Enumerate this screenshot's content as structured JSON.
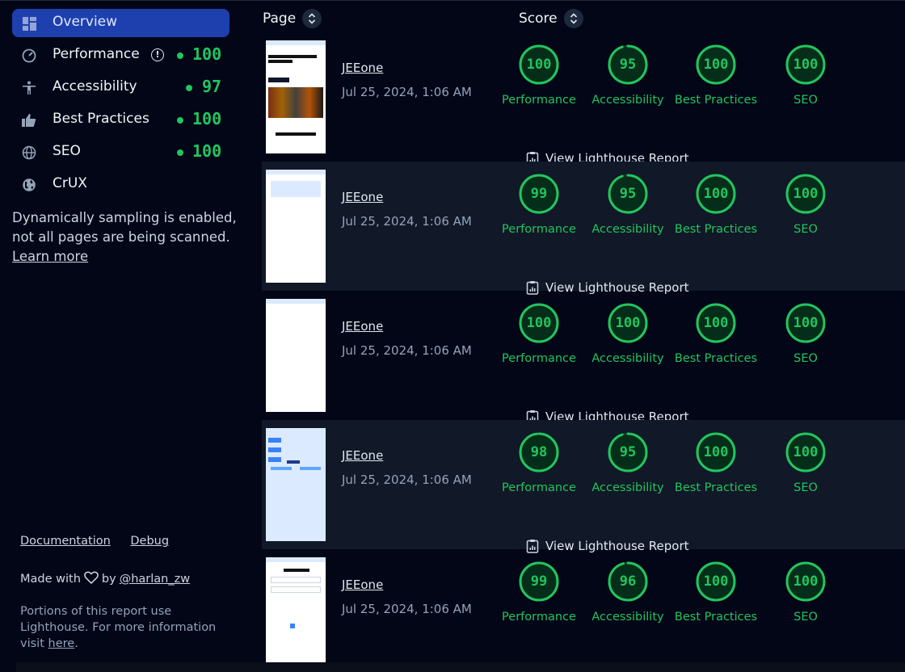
{
  "sidebar": {
    "nav": [
      {
        "label": "Overview",
        "icon": "dashboard-icon",
        "score": ""
      },
      {
        "label": "Performance",
        "icon": "speedometer-icon",
        "score": "100"
      },
      {
        "label": "Accessibility",
        "icon": "person-icon",
        "score": "97"
      },
      {
        "label": "Best Practices",
        "icon": "thumbs-up-icon",
        "score": "100"
      },
      {
        "label": "SEO",
        "icon": "globe-icon",
        "score": "100"
      },
      {
        "label": "CrUX",
        "icon": "earth-icon",
        "score": ""
      }
    ],
    "sampling_note": "Dynamically sampling is enabled, not all pages are being scanned.",
    "learn_more": "Learn more",
    "links": {
      "documentation": "Documentation",
      "debug": "Debug"
    },
    "made_with": {
      "prefix": "Made with",
      "by": "by",
      "handle": "@harlan_zw"
    },
    "portions": {
      "text": "Portions of this report use Lighthouse. For more information visit",
      "link": "here",
      "suffix": "."
    }
  },
  "table": {
    "page_header": "Page",
    "score_header": "Score",
    "report_label": "View Lighthouse Report",
    "category_labels": [
      "Performance",
      "Accessibility",
      "Best Practices",
      "SEO"
    ],
    "rows": [
      {
        "site": "JEEone",
        "date": "Jul 25, 2024, 1:06 AM",
        "scores": [
          "100",
          "95",
          "100",
          "100"
        ],
        "thumb": "home"
      },
      {
        "site": "JEEone",
        "date": "Jul 25, 2024, 1:06 AM",
        "scores": [
          "99",
          "95",
          "100",
          "100"
        ],
        "thumb": "test"
      },
      {
        "site": "JEEone",
        "date": "Jul 25, 2024, 1:06 AM",
        "scores": [
          "100",
          "100",
          "100",
          "100"
        ],
        "thumb": "blank"
      },
      {
        "site": "JEEone",
        "date": "Jul 25, 2024, 1:06 AM",
        "scores": [
          "98",
          "95",
          "100",
          "100"
        ],
        "thumb": "tree"
      },
      {
        "site": "JEEone",
        "date": "Jul 25, 2024, 1:06 AM",
        "scores": [
          "99",
          "96",
          "100",
          "100"
        ],
        "thumb": "list"
      }
    ]
  },
  "colors": {
    "accent": "#1e40af",
    "good": "#22c55e",
    "bg": "#020617",
    "row_alt": "#111827"
  }
}
